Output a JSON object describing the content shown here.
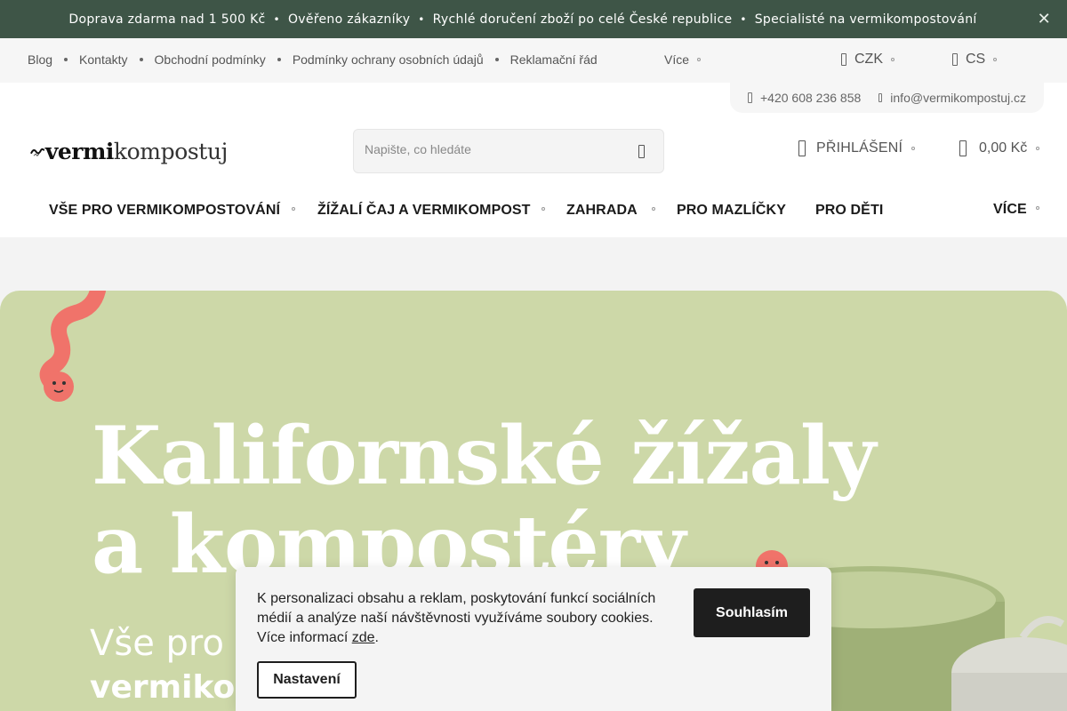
{
  "announcement": {
    "items": [
      "Doprava zdarma nad 1 500 Kč",
      "Ověřeno zákazníky",
      "Rychlé doručení zboží po celé České republice",
      "Specialisté na vermikompostování"
    ],
    "separator": "•",
    "close": "✕"
  },
  "utility": {
    "links": [
      "Blog",
      "Kontakty",
      "Obchodní podmínky",
      "Podmínky ochrany osobních údajů",
      "Reklamační řád"
    ],
    "more": "Více",
    "currency": "CZK",
    "language": "CS"
  },
  "contact": {
    "phone": "+420 608 236 858",
    "email": "info@vermikompostuj.cz"
  },
  "logo": {
    "bold": "vermi",
    "light": "kompostuj"
  },
  "search": {
    "placeholder": "Napište, co hledáte"
  },
  "account": {
    "login": "PŘIHLÁŠENÍ",
    "cart_total": "0,00 Kč"
  },
  "nav": {
    "items": [
      "VŠE PRO VERMIKOMPOSTOVÁNÍ",
      "ŽÍŽALÍ ČAJ A VERMIKOMPOST",
      "ZAHRADA",
      "PRO MAZLÍČKY",
      "PRO DĚTI"
    ],
    "more": "VÍCE"
  },
  "hero": {
    "headline_1": "Kalifornské žížaly",
    "headline_2": "a kompostéry",
    "sub_1": "Vše pro",
    "sub_2": "vermikompostování"
  },
  "cookie": {
    "text": "K personalizaci obsahu a reklam, poskytování funkcí sociálních médií a analýze naší návštěvnosti využíváme soubory cookies. Více informací ",
    "link": "zde",
    "after_link": ".",
    "agree": "Souhlasím",
    "settings": "Nastavení"
  },
  "colors": {
    "announce_bg": "#3e5547",
    "hero_bg": "#cdd8a8",
    "worm": "#f0736a",
    "button_dark": "#1e1e1e"
  }
}
